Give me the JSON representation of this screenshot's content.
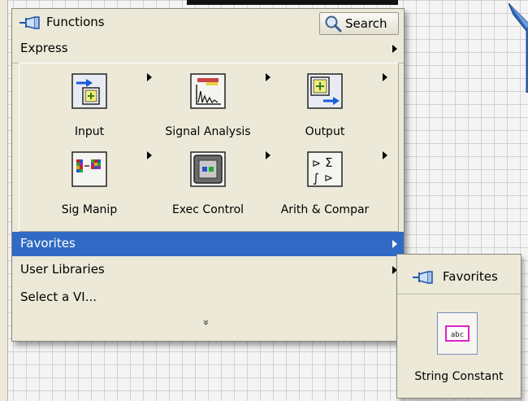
{
  "palette": {
    "title": "Functions",
    "search_label": "Search",
    "express_label": "Express",
    "tiles": [
      {
        "label": "Input",
        "icon": "input-icon"
      },
      {
        "label": "Signal Analysis",
        "icon": "signal-analysis-icon"
      },
      {
        "label": "Output",
        "icon": "output-icon"
      },
      {
        "label": "Sig Manip",
        "icon": "sig-manip-icon"
      },
      {
        "label": "Exec Control",
        "icon": "exec-control-icon"
      },
      {
        "label": "Arith & Compar",
        "icon": "arith-compar-icon"
      }
    ],
    "menu": {
      "favorites": "Favorites",
      "user_libraries": "User Libraries",
      "select_vi": "Select a VI..."
    },
    "more_glyph": "»"
  },
  "favorites_panel": {
    "title": "Favorites",
    "item_label": "String Constant",
    "item_icon_text": "abc"
  },
  "colors": {
    "highlight": "#316ac5",
    "panel": "#ece9d8",
    "arrow_blue": "#2e66b8"
  }
}
